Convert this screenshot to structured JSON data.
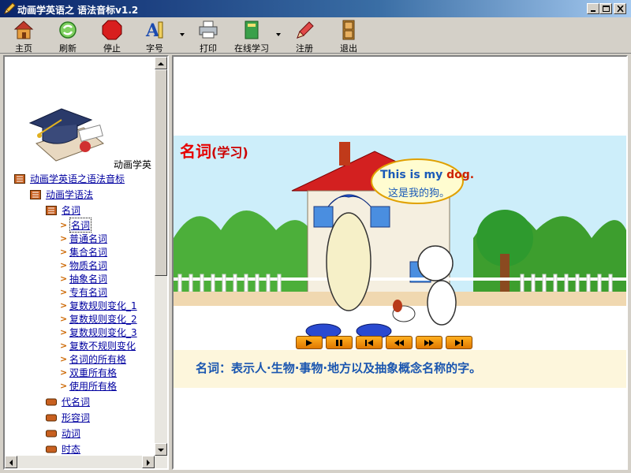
{
  "window": {
    "title": "动画学英语之 语法音标v1.2",
    "app_icon": "pencil-icon"
  },
  "titlebar_buttons": [
    {
      "name": "minimize",
      "icon": "minimize-icon"
    },
    {
      "name": "maximize",
      "icon": "maximize-icon"
    },
    {
      "name": "close",
      "icon": "close-icon"
    }
  ],
  "toolbar": {
    "home": {
      "label": "主页",
      "icon": "house-icon"
    },
    "refresh": {
      "label": "刷新",
      "icon": "refresh-icon"
    },
    "stop": {
      "label": "停止",
      "icon": "stop-icon"
    },
    "font": {
      "label": "字号",
      "icon": "font-size-icon"
    },
    "print": {
      "label": "打印",
      "icon": "printer-icon"
    },
    "online": {
      "label": "在线学习",
      "icon": "book-icon"
    },
    "register": {
      "label": "注册",
      "icon": "pencil-icon"
    },
    "exit": {
      "label": "退出",
      "icon": "door-icon"
    }
  },
  "leftpane": {
    "logo": "graduation-cap-icon",
    "clipped_text": "动画学英",
    "tree": {
      "root": "动画学英语之语法音标",
      "grammar": "动画学语法",
      "noun": "名词",
      "noun_items": [
        "名词",
        "普通名词",
        "集合名词",
        "物质名词",
        "抽象名词",
        "专有名词",
        "复数规则变化_1",
        "复数规则变化_2",
        "复数规则变化_3",
        "复数不规则变化",
        "名词的所有格",
        "双重所有格",
        "使用所有格"
      ],
      "others": [
        "代名词",
        "形容词",
        "动词",
        "时态"
      ],
      "selected_item": "名词"
    }
  },
  "content": {
    "title_main": "名词",
    "title_sub": "(学习)",
    "bubble_en_prefix": "This is my ",
    "bubble_en_word": "dog.",
    "bubble_cn": "这是我的狗。",
    "caption": "名词：表示人·生物·事物·地方以及抽象概念名称的字。",
    "controls": [
      "play-icon",
      "pause-icon",
      "rewind-to-start-icon",
      "rewind-icon",
      "fast-forward-icon",
      "skip-to-end-icon"
    ]
  },
  "colors": {
    "title_bar": "#0a246a",
    "title_red": "#e60000",
    "caption_blue": "#1a56b0",
    "control_orange": "#f09010"
  }
}
